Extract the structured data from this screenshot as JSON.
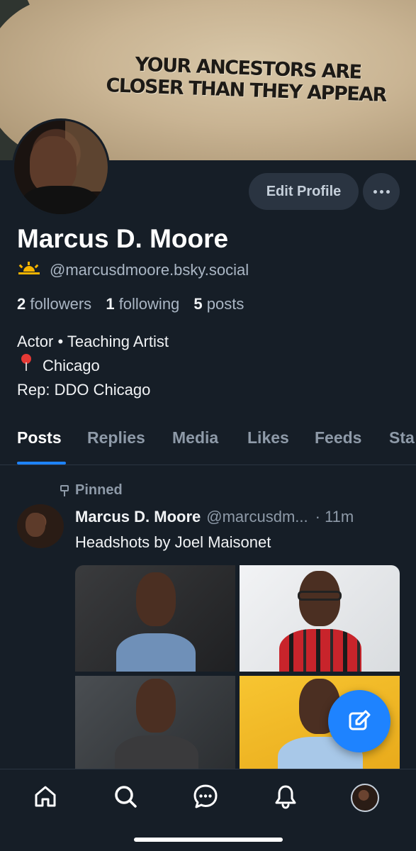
{
  "banner": {
    "line1": "YOUR ANCESTORS ARE",
    "line2": "CLOSER THAN THEY APPEAR"
  },
  "actions": {
    "edit_profile": "Edit Profile"
  },
  "profile": {
    "name": "Marcus D. Moore",
    "handle": "@marcusdmoore.bsky.social",
    "followers_count": "2",
    "followers_label": "followers",
    "following_count": "1",
    "following_label": "following",
    "posts_count": "5",
    "posts_label": "posts",
    "bio_line1": "Actor • Teaching Artist",
    "bio_line2": "Chicago",
    "bio_line3": "Rep: DDO Chicago"
  },
  "tabs": [
    {
      "label": "Posts",
      "active": true
    },
    {
      "label": "Replies"
    },
    {
      "label": "Media"
    },
    {
      "label": "Likes"
    },
    {
      "label": "Feeds"
    },
    {
      "label": "Sta"
    }
  ],
  "post": {
    "pinned_label": "Pinned",
    "author": "Marcus D. Moore",
    "handle": "@marcusdm...",
    "time": "· 11m",
    "text": "Headshots by Joel Maisonet"
  },
  "colors": {
    "background": "#161e27",
    "accent": "#1e83ff",
    "muted_text": "#8e9aa8",
    "button_bg": "#2a3441"
  },
  "icons": {
    "emoji": "sunrise-icon",
    "location": "round-pushpin-icon",
    "pinned": "pin-icon",
    "fab": "compose-icon",
    "nav": [
      "home-icon",
      "search-icon",
      "chat-icon",
      "bell-icon",
      "profile-avatar"
    ]
  }
}
